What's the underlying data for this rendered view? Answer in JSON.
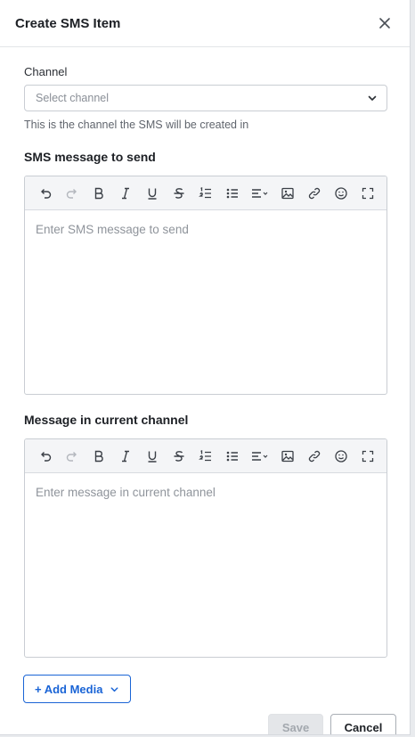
{
  "modal": {
    "title": "Create SMS Item",
    "close_label": "close"
  },
  "channel": {
    "label": "Channel",
    "placeholder": "Select channel",
    "helper": "This is the channel the SMS will be created in"
  },
  "sms_editor": {
    "label": "SMS message to send",
    "placeholder": "Enter SMS message to send"
  },
  "current_editor": {
    "label": "Message in current channel",
    "placeholder": "Enter message in current channel"
  },
  "toolbar_icons": [
    "undo-icon",
    "redo-icon",
    "bold-icon",
    "italic-icon",
    "underline-icon",
    "strikethrough-icon",
    "ordered-list-icon",
    "bullet-list-icon",
    "align-icon",
    "image-icon",
    "link-icon",
    "emoji-icon",
    "fullscreen-icon"
  ],
  "add_media": {
    "label": "+ Add Media"
  },
  "footer": {
    "save_label": "Save",
    "cancel_label": "Cancel"
  },
  "colors": {
    "accent": "#1a64d6",
    "border": "#c9cdd3",
    "toolbar_bg": "#f4f5f7",
    "disabled": "#a3a8ae"
  }
}
